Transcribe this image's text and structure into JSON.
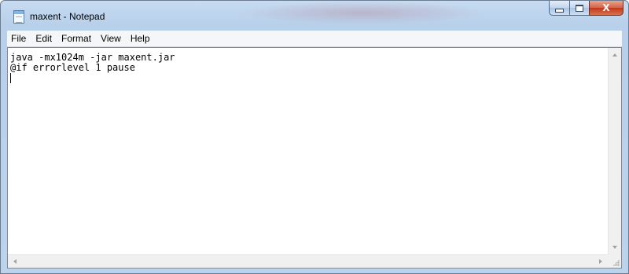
{
  "window": {
    "title": "maxent - Notepad",
    "icon": "notepad-icon",
    "caption_buttons": {
      "minimize_icon": "minimize-icon",
      "maximize_icon": "maximize-icon",
      "close_label": "X"
    }
  },
  "menubar": {
    "items": [
      {
        "label": "File"
      },
      {
        "label": "Edit"
      },
      {
        "label": "Format"
      },
      {
        "label": "View"
      },
      {
        "label": "Help"
      }
    ]
  },
  "editor": {
    "lines": [
      "java -mx1024m -jar maxent.jar",
      "@if errorlevel 1 pause",
      ""
    ]
  },
  "colors": {
    "frame": "#bcd3ec",
    "close_button": "#c0381a",
    "menubar": "#f5f6f7",
    "editor_bg": "#ffffff"
  }
}
